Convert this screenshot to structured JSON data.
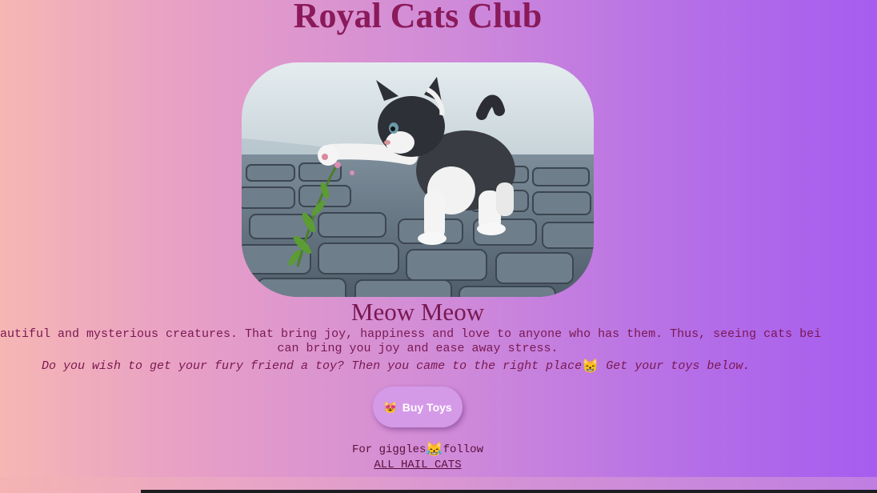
{
  "header": {
    "title": "Royal Cats Club"
  },
  "hero": {
    "image_subject": "black-and-white kitten pawing at a small plant on cobblestones"
  },
  "main": {
    "subtitle": "Meow Meow",
    "description_line1": "eautiful and mysterious creatures. That bring joy, happiness and love to anyone who has them. Thus, seeing cats bei",
    "description_line2": "can bring you joy and ease away stress.",
    "cta_text_before": "Do you wish to get your fury friend a toy? Then you came to the right place",
    "cta_emoji": "😸",
    "cta_text_after": " Get your toys below."
  },
  "buy_button": {
    "emoji": "😻",
    "label": "Buy Toys"
  },
  "follow": {
    "text_before": "For giggles",
    "emoji": "😹",
    "text_after": "follow",
    "link_label": "ALL HAIL CATS"
  },
  "colors": {
    "title": "#8b1a5a",
    "text": "#7a1852",
    "button_bg": "#d49ae8",
    "gradient_left": "#f6b6b4",
    "gradient_right": "#a65cee"
  }
}
